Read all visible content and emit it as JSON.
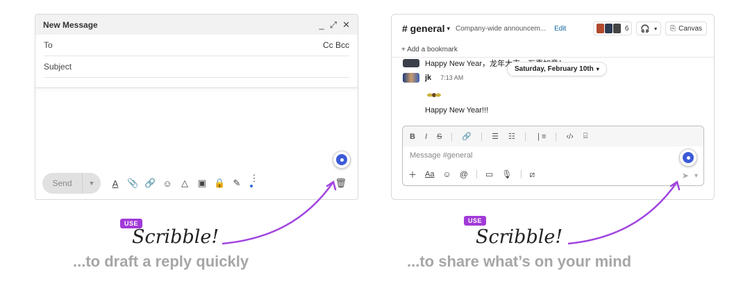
{
  "gmail": {
    "title": "New Message",
    "to_label": "To",
    "cc_bcc": "Cc Bcc",
    "subject_placeholder": "Subject",
    "send_label": "Send",
    "controls": {
      "minimize": "_",
      "expand": "⤢",
      "close": "✕"
    }
  },
  "slack": {
    "channel": "# general",
    "topic": "Company-wide announcem...",
    "edit_label": "Edit",
    "member_count": "6",
    "canvas_label": "Canvas",
    "bookmark_label": "+  Add a bookmark",
    "msg_prev": "Happy New Year，龙年大吉，万事如意！",
    "date_pill": "Saturday, February 10th",
    "user": "jk",
    "time": "7:13 AM",
    "message": "Happy New Year!!!",
    "placeholder": "Message #general"
  },
  "captions": {
    "badge": "USE",
    "logo": "Scribble!",
    "left": "...to draft a reply quickly",
    "right": "...to share what’s on your mind"
  },
  "colors": {
    "scribble_blue": "#3c5ad8",
    "badge_purple": "#a13ad8",
    "arrow_purple": "#a245e0"
  }
}
